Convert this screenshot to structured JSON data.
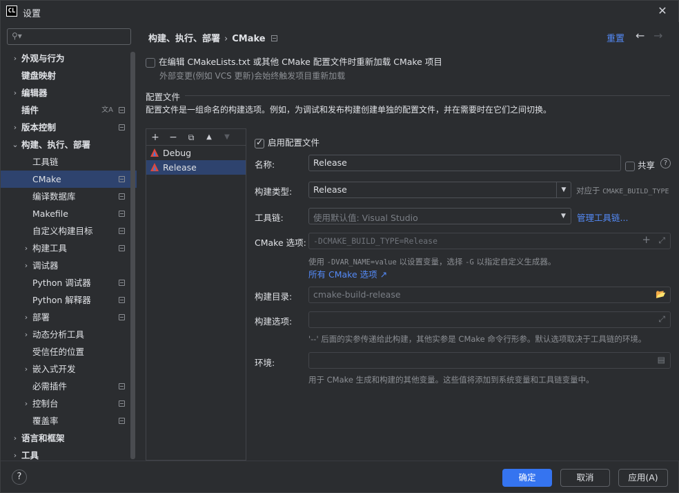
{
  "window": {
    "title": "设置",
    "logo_text": "CL"
  },
  "sidebar": {
    "search_placeholder": "",
    "items": [
      {
        "label": "外观与行为",
        "arrow": "›",
        "bold": true,
        "icon": ""
      },
      {
        "label": "键盘映射",
        "arrow": "",
        "bold": true,
        "icon": ""
      },
      {
        "label": "编辑器",
        "arrow": "›",
        "bold": true,
        "icon": ""
      },
      {
        "label": "插件",
        "arrow": "",
        "bold": true,
        "icon": "translate"
      },
      {
        "label": "版本控制",
        "arrow": "›",
        "bold": true,
        "icon": "project"
      },
      {
        "label": "构建、执行、部署",
        "arrow": "⌄",
        "bold": true,
        "icon": ""
      },
      {
        "label": "工具链",
        "arrow": "",
        "bold": false,
        "icon": ""
      },
      {
        "label": "CMake",
        "arrow": "",
        "bold": false,
        "icon": "project",
        "selected": true
      },
      {
        "label": "编译数据库",
        "arrow": "",
        "bold": false,
        "icon": "project"
      },
      {
        "label": "Makefile",
        "arrow": "",
        "bold": false,
        "icon": "project"
      },
      {
        "label": "自定义构建目标",
        "arrow": "",
        "bold": false,
        "icon": "project"
      },
      {
        "label": "构建工具",
        "arrow": "›",
        "bold": false,
        "icon": "project"
      },
      {
        "label": "调试器",
        "arrow": "›",
        "bold": false,
        "icon": ""
      },
      {
        "label": "Python 调试器",
        "arrow": "",
        "bold": false,
        "icon": "project"
      },
      {
        "label": "Python 解释器",
        "arrow": "",
        "bold": false,
        "icon": "project"
      },
      {
        "label": "部署",
        "arrow": "›",
        "bold": false,
        "icon": "project"
      },
      {
        "label": "动态分析工具",
        "arrow": "›",
        "bold": false,
        "icon": ""
      },
      {
        "label": "受信任的位置",
        "arrow": "",
        "bold": false,
        "icon": ""
      },
      {
        "label": "嵌入式开发",
        "arrow": "›",
        "bold": false,
        "icon": ""
      },
      {
        "label": "必需插件",
        "arrow": "",
        "bold": false,
        "icon": "project"
      },
      {
        "label": "控制台",
        "arrow": "›",
        "bold": false,
        "icon": "project"
      },
      {
        "label": "覆盖率",
        "arrow": "",
        "bold": false,
        "icon": "project"
      },
      {
        "label": "语言和框架",
        "arrow": "›",
        "bold": true,
        "icon": ""
      },
      {
        "label": "工具",
        "arrow": "›",
        "bold": true,
        "icon": ""
      }
    ]
  },
  "header": {
    "breadcrumb_parent": "构建、执行、部署",
    "breadcrumb_sep": "›",
    "breadcrumb_current": "CMake",
    "reset_label": "重置",
    "back_icon": "←",
    "forward_icon": "→"
  },
  "reload": {
    "label": "在编辑 CMakeLists.txt 或其他 CMake 配置文件时重新加载 CMake 项目",
    "checked": false,
    "hint": "外部变更(例如 VCS 更新)会始终触发项目重新加载"
  },
  "profiles_section": {
    "title": "配置文件",
    "description": "配置文件是一组命名的构建选项。例如，为调试和发布构建创建单独的配置文件，并在需要时在它们之间切换。",
    "toolbar": {
      "add": "+",
      "remove": "−",
      "copy": "⧉",
      "up": "▲",
      "down": "▼"
    },
    "profiles": [
      {
        "name": "Debug",
        "selected": false
      },
      {
        "name": "Release",
        "selected": true
      }
    ]
  },
  "form": {
    "enable_label": "启用配置文件",
    "enable_checked": true,
    "name_label": "名称:",
    "name_value": "Release",
    "share_label": "共享",
    "build_type_label": "构建类型:",
    "build_type_value": "Release",
    "applies_prefix": "对应于",
    "applies_var": "CMAKE_BUILD_TYPE",
    "toolchain_label": "工具链:",
    "toolchain_value": "使用默认值: Visual Studio",
    "manage_toolchains": "管理工具链...",
    "cmake_options_label": "CMake 选项:",
    "cmake_options_value": "-DCMAKE_BUILD_TYPE=Release",
    "cmake_hint_1": "使用",
    "cmake_hint_var": "-DVAR_NAME=value",
    "cmake_hint_2": "以设置变量，选择",
    "cmake_hint_g": "-G",
    "cmake_hint_3": "以指定自定义生成器。",
    "all_options_link": "所有 CMake 选项 ↗",
    "build_dir_label": "构建目录:",
    "build_dir_value": "cmake-build-release",
    "build_options_label": "构建选项:",
    "build_options_value": "",
    "build_options_hint": "'--' 后面的实参传递给此构建，其他实参是 CMake 命令行形参。默认选项取决于工具链的环境。",
    "env_label": "环境:",
    "env_value": "",
    "env_hint": "用于 CMake 生成和构建的其他变量。这些值将添加到系统变量和工具链变量中。"
  },
  "footer": {
    "help": "?",
    "ok": "确定",
    "cancel": "取消",
    "apply": "应用(A)"
  }
}
